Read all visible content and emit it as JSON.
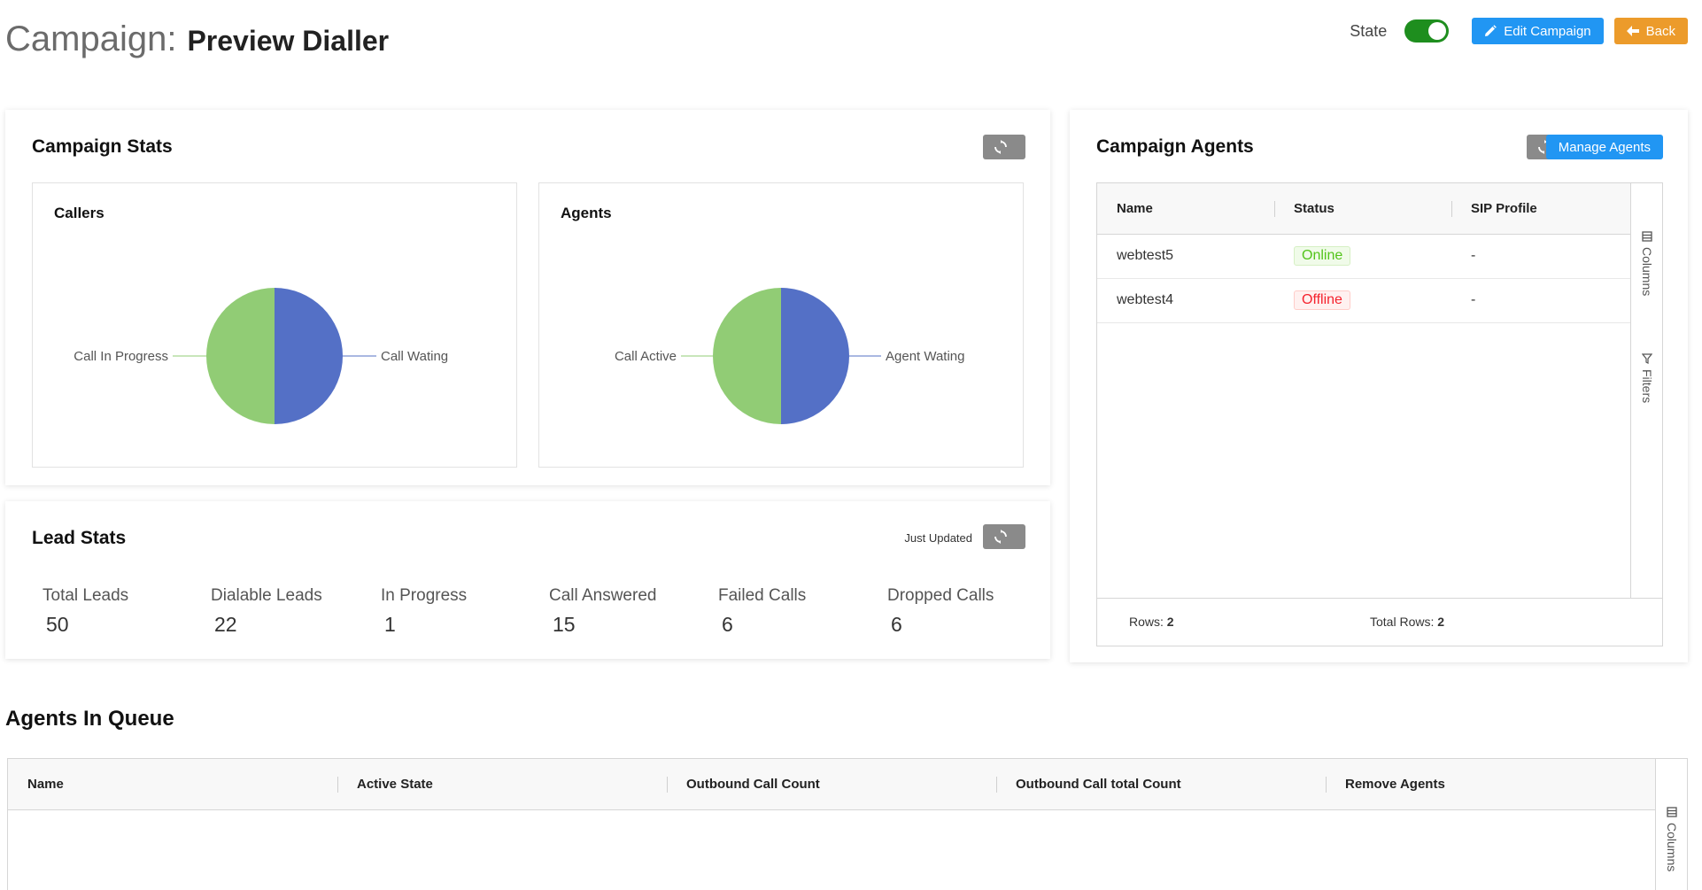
{
  "header": {
    "title_prefix": "Campaign:",
    "campaign_name": "Preview Dialler",
    "state_label": "State",
    "state_on": true,
    "edit_label": "Edit Campaign",
    "back_label": "Back"
  },
  "campaign_stats": {
    "title": "Campaign Stats",
    "callers": {
      "title": "Callers",
      "labels": [
        "Call In Progress",
        "Call Wating"
      ],
      "colors": [
        "#91cc75",
        "#5470c6"
      ]
    },
    "agents": {
      "title": "Agents",
      "labels": [
        "Call Active",
        "Agent Wating"
      ],
      "colors": [
        "#91cc75",
        "#5470c6"
      ]
    }
  },
  "lead_stats": {
    "title": "Lead Stats",
    "updated_text": "Just Updated",
    "items": [
      {
        "label": "Total Leads",
        "value": "50"
      },
      {
        "label": "Dialable Leads",
        "value": "22"
      },
      {
        "label": "In Progress",
        "value": "1"
      },
      {
        "label": "Call Answered",
        "value": "15"
      },
      {
        "label": "Failed Calls",
        "value": "6"
      },
      {
        "label": "Dropped Calls",
        "value": "6"
      }
    ]
  },
  "campaign_agents": {
    "title": "Campaign Agents",
    "manage_label": "Manage Agents",
    "columns": [
      "Name",
      "Status",
      "SIP Profile"
    ],
    "rows": [
      {
        "name": "webtest5",
        "status": "Online",
        "sip": "-"
      },
      {
        "name": "webtest4",
        "status": "Offline",
        "sip": "-"
      }
    ],
    "side_columns": "Columns",
    "side_filters": "Filters",
    "rows_label": "Rows:",
    "rows_count": "2",
    "total_rows_label": "Total Rows:",
    "total_rows_count": "2"
  },
  "agents_in_queue": {
    "title": "Agents In Queue",
    "columns": [
      "Name",
      "Active State",
      "Outbound Call Count",
      "Outbound Call total Count",
      "Remove Agents"
    ],
    "side_columns": "Columns"
  }
}
